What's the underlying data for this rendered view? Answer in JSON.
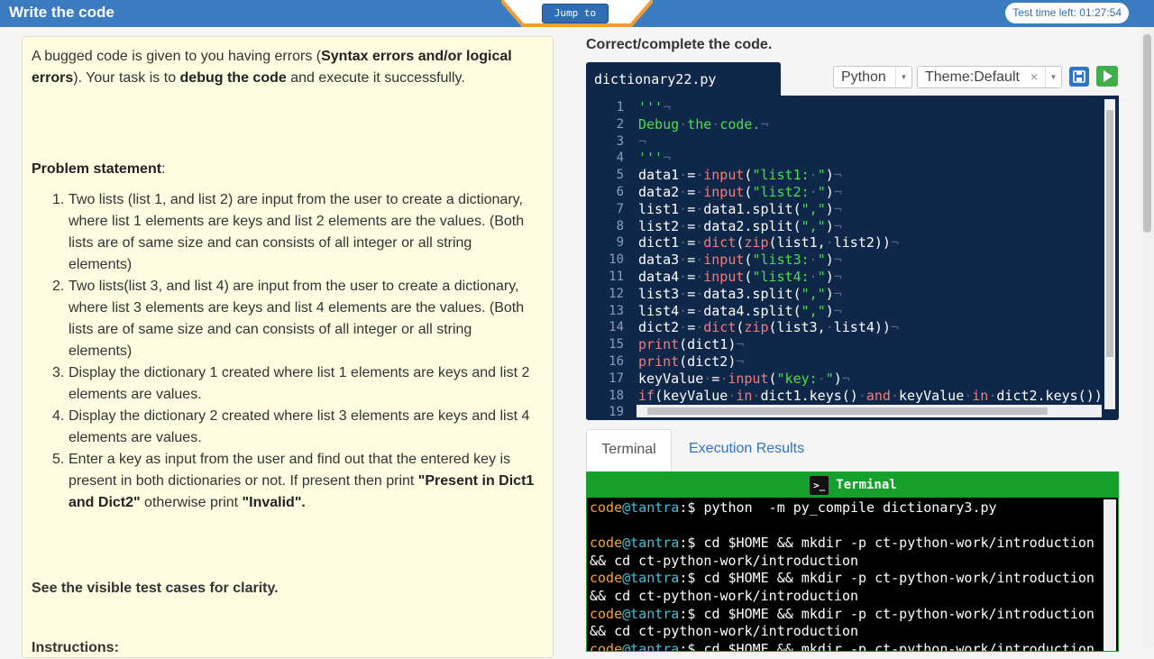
{
  "header": {
    "title": "Write the code",
    "jump_label": "Jump to",
    "time_left": "Test time left: 01:27:54"
  },
  "problem": {
    "intro_parts": [
      "A bugged code is given to you having errors (",
      "Syntax errors and/or logical errors",
      "). Your task is to ",
      "debug the code",
      " and execute it successfully."
    ],
    "statement_heading": "Problem statement",
    "statement_colon": ":",
    "items": [
      {
        "num": "1.",
        "text": "Two lists (list 1, and list 2) are input from the user to create a dictionary, where list 1 elements are keys and list 2 elements are the values. (Both lists are of same size and can consists of all integer or all string elements)"
      },
      {
        "num": "2.",
        "text": "Two lists(list 3, and list 4) are input from the user to create a dictionary, where list 3 elements are keys and list 4 elements are the values. (Both lists are of same size and can consists of all integer or all string elements)"
      },
      {
        "num": "3.",
        "text": "Display the dictionary 1 created where list 1 elements are keys and list 2 elements are values."
      },
      {
        "num": "4.",
        "text": "Display the dictionary 2 created where list 3 elements are keys and list 4 elements are values."
      }
    ],
    "item5": {
      "num": "5.",
      "text_before": "Enter a key as input from the user and find out that the entered key is present in both dictionaries or not. If present then print ",
      "present_text": "\"Present in Dict1 and Dict2\"",
      "middle": " otherwise print ",
      "invalid_text": "\"Invalid\"."
    },
    "see_visible": "See the visible test cases for clarity.",
    "instructions": "Instructions:"
  },
  "editor": {
    "heading": "Correct/complete the code.",
    "filename": "dictionary22.py",
    "language": "Python",
    "theme": "Theme:Default",
    "lines": [
      {
        "n": "1"
      },
      {
        "n": "2"
      },
      {
        "n": "3"
      },
      {
        "n": "4"
      },
      {
        "n": "5"
      },
      {
        "n": "6"
      },
      {
        "n": "7"
      },
      {
        "n": "8"
      },
      {
        "n": "9"
      },
      {
        "n": "10"
      },
      {
        "n": "11"
      },
      {
        "n": "12"
      },
      {
        "n": "13"
      },
      {
        "n": "14"
      },
      {
        "n": "15"
      },
      {
        "n": "16"
      },
      {
        "n": "17"
      },
      {
        "n": "18"
      },
      {
        "n": "19"
      }
    ]
  },
  "tabs": {
    "terminal": "Terminal",
    "execution_results": "Execution Results"
  },
  "terminal": {
    "header": "Terminal",
    "icon": ">_",
    "user": "code",
    "host": "@tantra",
    "prompt_suffix": ":$ ",
    "cmd1": "python  -m py_compile dictionary3.py",
    "cmd2": "cd $HOME && mkdir -p ct-python-work/introduction && cd ct-python-work/introduction"
  },
  "colors": {
    "topbar": "#3b7bbf",
    "editor_bg": "#0f2748",
    "terminal_header": "#16a02c",
    "string": "#4ade4a",
    "keyword": "#f47c7c"
  }
}
